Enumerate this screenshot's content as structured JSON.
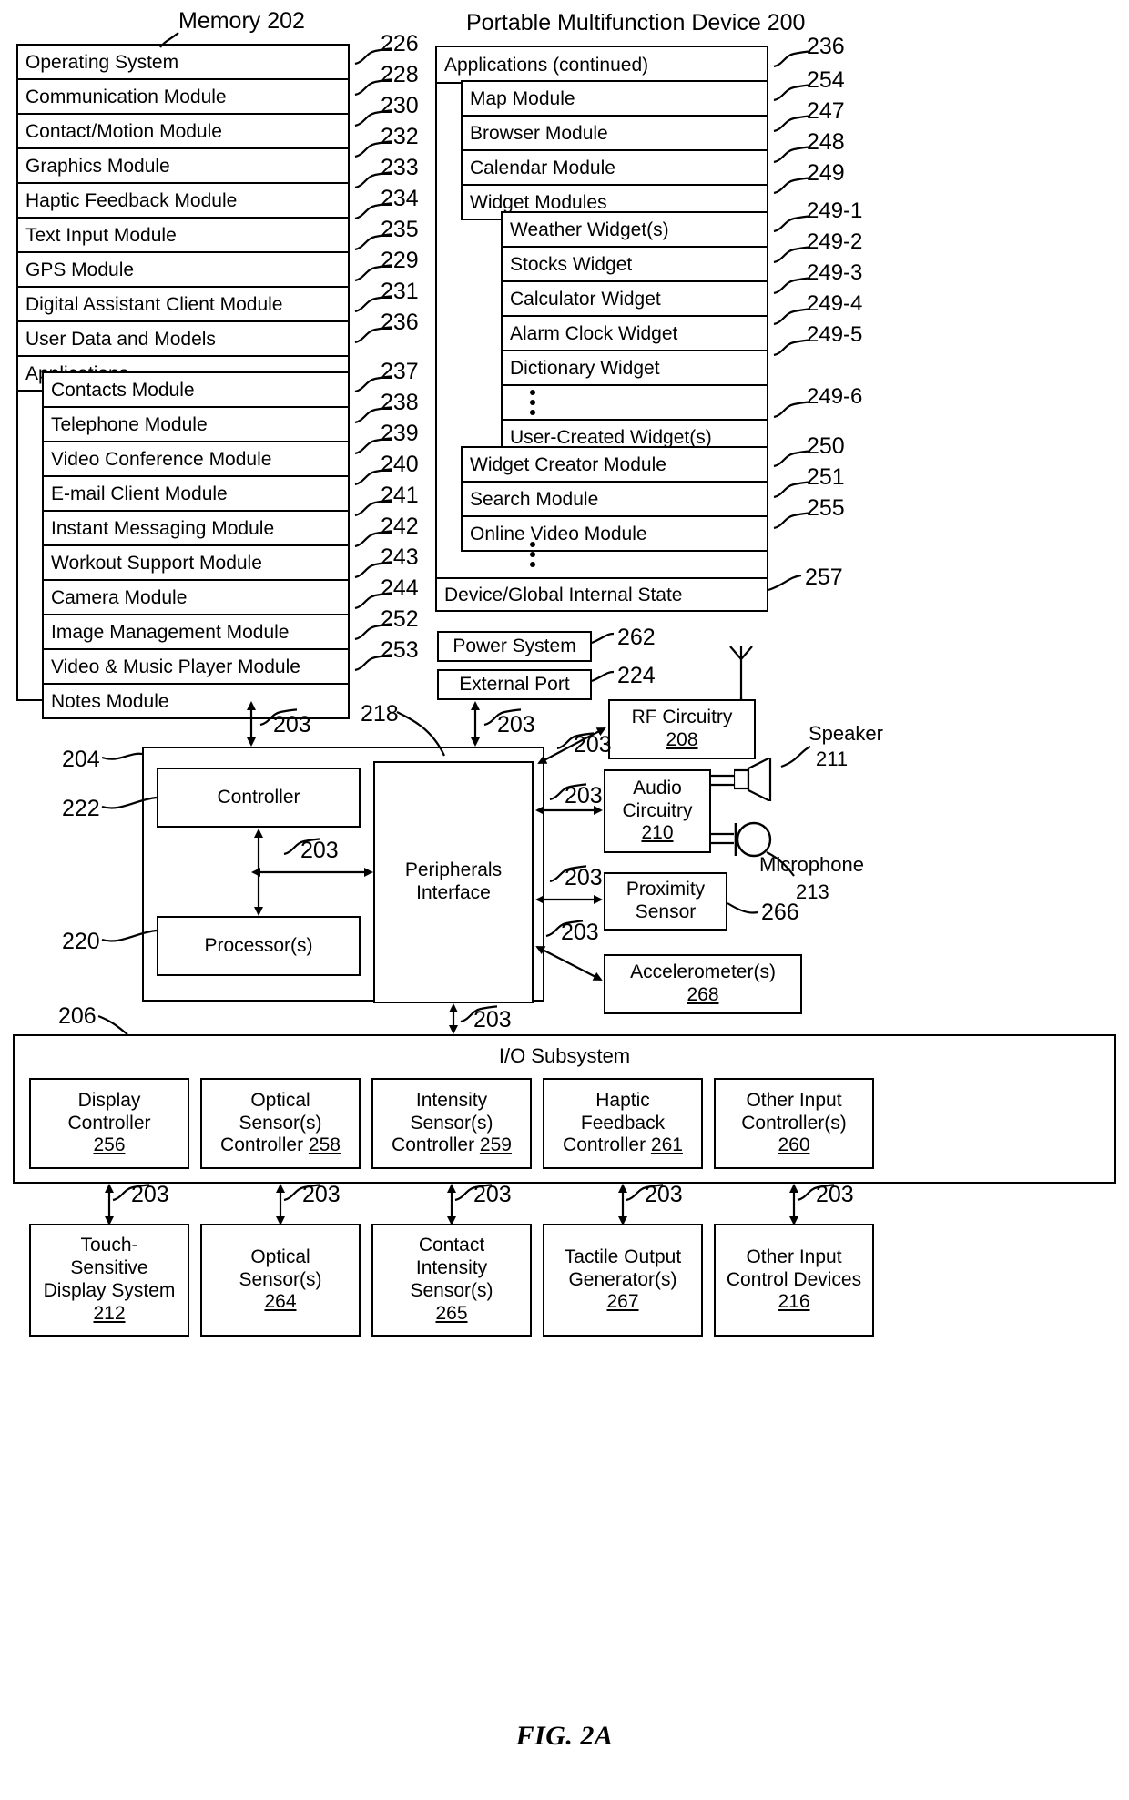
{
  "figure": {
    "label": "FIG. 2A"
  },
  "titles": {
    "memory": "Memory 202",
    "memory_num": "202",
    "device": "Portable Multifunction Device 200",
    "device_num": "200"
  },
  "memory_column": {
    "items": [
      {
        "label": "Operating System",
        "ref": "226"
      },
      {
        "label": "Communication Module",
        "ref": "228"
      },
      {
        "label": "Contact/Motion Module",
        "ref": "230"
      },
      {
        "label": "Graphics Module",
        "ref": "232"
      },
      {
        "label": "Haptic Feedback Module",
        "ref": "233"
      },
      {
        "label": "Text Input Module",
        "ref": "234"
      },
      {
        "label": "GPS Module",
        "ref": "235"
      },
      {
        "label": "Digital Assistant Client Module",
        "ref": "229"
      },
      {
        "label": "User Data and Models",
        "ref": "231"
      },
      {
        "label": "Applications",
        "ref": "236"
      }
    ],
    "applications": [
      {
        "label": "Contacts Module",
        "ref": "237"
      },
      {
        "label": "Telephone Module",
        "ref": "238"
      },
      {
        "label": "Video Conference Module",
        "ref": "239"
      },
      {
        "label": "E-mail Client Module",
        "ref": "240"
      },
      {
        "label": "Instant Messaging Module",
        "ref": "241"
      },
      {
        "label": "Workout Support Module",
        "ref": "242"
      },
      {
        "label": "Camera Module",
        "ref": "243"
      },
      {
        "label": "Image Management Module",
        "ref": "244"
      },
      {
        "label": "Video & Music Player Module",
        "ref": "252"
      },
      {
        "label": "Notes Module",
        "ref": "253"
      }
    ]
  },
  "applications_continued": {
    "header": "Applications (continued)",
    "header_ref": "236",
    "items": [
      {
        "label": "Map Module",
        "ref": "254"
      },
      {
        "label": "Browser Module",
        "ref": "247"
      },
      {
        "label": "Calendar Module",
        "ref": "248"
      },
      {
        "label": "Widget Modules",
        "ref": "249"
      }
    ],
    "widgets": [
      {
        "label": "Weather Widget(s)",
        "ref": "249-1"
      },
      {
        "label": "Stocks Widget",
        "ref": "249-2"
      },
      {
        "label": "Calculator Widget",
        "ref": "249-3"
      },
      {
        "label": "Alarm Clock Widget",
        "ref": "249-4"
      },
      {
        "label": "Dictionary Widget",
        "ref": "249-5"
      },
      {
        "label": "",
        "ref": "",
        "ellipsis": true
      },
      {
        "label": "User-Created Widget(s)",
        "ref": "249-6"
      }
    ],
    "tail": [
      {
        "label": "Widget Creator Module",
        "ref": "250"
      },
      {
        "label": "Search Module",
        "ref": "251"
      },
      {
        "label": "Online Video Module",
        "ref": "255"
      }
    ],
    "device_state": {
      "label": "Device/Global Internal State",
      "ref": "257"
    }
  },
  "power": [
    {
      "label": "Power System",
      "ref": "262"
    },
    {
      "label": "External Port",
      "ref": "224"
    }
  ],
  "core": {
    "controller": "Controller",
    "processors": "Processor(s)",
    "peripherals_line1": "Peripherals",
    "peripherals_line2": "Interface",
    "ref_outer": "204",
    "ref_controller": "222",
    "ref_processor": "220",
    "ref_peripherals": "218",
    "bus": "203"
  },
  "peripherals_right": [
    {
      "line1": "RF Circuitry",
      "num": "208"
    },
    {
      "line1": "Audio",
      "line2": "Circuitry",
      "num": "210"
    },
    {
      "line1": "Proximity",
      "line2": "Sensor",
      "ref": "266"
    },
    {
      "line1": "Accelerometer(s)",
      "num": "268"
    }
  ],
  "transducers": {
    "speaker": {
      "name": "Speaker",
      "num": "211"
    },
    "microphone": {
      "name": "Microphone",
      "num": "213"
    }
  },
  "io_subsystem": {
    "title": "I/O Subsystem",
    "ref": "206",
    "controllers": [
      {
        "line1": "Display",
        "line2": "Controller",
        "num": "256"
      },
      {
        "line1": "Optical",
        "line2": "Sensor(s)",
        "line3": "Controller",
        "num": "258"
      },
      {
        "line1": "Intensity",
        "line2": "Sensor(s)",
        "line3": "Controller",
        "num": "259"
      },
      {
        "line1": "Haptic",
        "line2": "Feedback",
        "line3": "Controller",
        "num": "261"
      },
      {
        "line1": "Other Input",
        "line2": "Controller(s)",
        "num": "260"
      }
    ],
    "devices": [
      {
        "line1": "Touch-",
        "line2": "Sensitive",
        "line3": "Display System",
        "num": "212"
      },
      {
        "line1": "Optical",
        "line2": "Sensor(s)",
        "num": "264"
      },
      {
        "line1": "Contact",
        "line2": "Intensity",
        "line3": "Sensor(s)",
        "num": "265"
      },
      {
        "line1": "Tactile Output",
        "line2": "Generator(s)",
        "num": "267"
      },
      {
        "line1": "Other Input",
        "line2": "Control Devices",
        "num": "216"
      }
    ],
    "bus": "203"
  },
  "colors": {
    "ink": "#000000",
    "paper": "#ffffff"
  }
}
